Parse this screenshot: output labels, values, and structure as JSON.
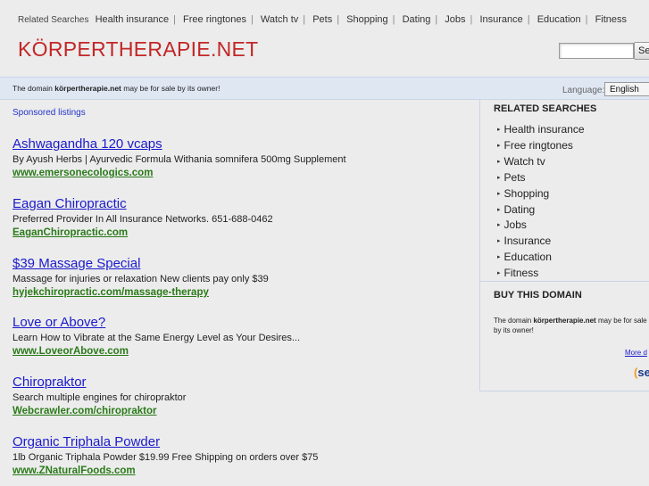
{
  "topbar": {
    "lead": "Related Searches",
    "links": [
      "Health insurance",
      "Free ringtones",
      "Watch tv",
      "Pets",
      "Shopping",
      "Dating",
      "Jobs",
      "Insurance",
      "Education",
      "Fitness"
    ]
  },
  "header": {
    "title": "KÖRPERTHERAPIE.NET",
    "search_value": "",
    "search_button": "Se"
  },
  "sale_bar": {
    "msg_before": "The domain ",
    "domain": "körpertherapie.net",
    "msg_after": " may be for sale by its owner!",
    "language_label": "Language:",
    "language_value": "English"
  },
  "main": {
    "sponsored_label": "Sponsored listings",
    "listings": [
      {
        "title": "Ashwagandha 120 vcaps",
        "desc": "By Ayush Herbs | Ayurvedic Formula Withania somnifera 500mg Supplement",
        "url": "www.emersonecologics.com"
      },
      {
        "title": "Eagan Chiropractic",
        "desc": "Preferred Provider In All Insurance Networks. 651-688-0462",
        "url": "EaganChiropractic.com"
      },
      {
        "title": "$39 Massage Special",
        "desc": "Massage for injuries or relaxation New clients pay only $39",
        "url": "hyjekchiropractic.com/massage-therapy"
      },
      {
        "title": "Love or Above?",
        "desc": "Learn How to Vibrate at the Same Energy Level as Your Desires...",
        "url": "www.LoveorAbove.com"
      },
      {
        "title": "Chiropraktor",
        "desc": "Search multiple engines for chiropraktor",
        "url": "Webcrawler.com/chiropraktor"
      },
      {
        "title": "Organic Triphala Powder",
        "desc": "1lb Organic Triphala Powder $19.99 Free Shipping on orders over $75",
        "url": "www.ZNaturalFoods.com"
      }
    ]
  },
  "sidebar": {
    "related_heading": "RELATED SEARCHES",
    "related": [
      "Health insurance",
      "Free ringtones",
      "Watch tv",
      "Pets",
      "Shopping",
      "Dating",
      "Jobs",
      "Insurance",
      "Education",
      "Fitness"
    ],
    "buy_heading": "BUY THIS DOMAIN",
    "buy_before": "The domain ",
    "buy_domain": "körpertherapie.net",
    "buy_after": " may be for sale by its owner!",
    "more_link": "More d",
    "logo_text": "se"
  }
}
